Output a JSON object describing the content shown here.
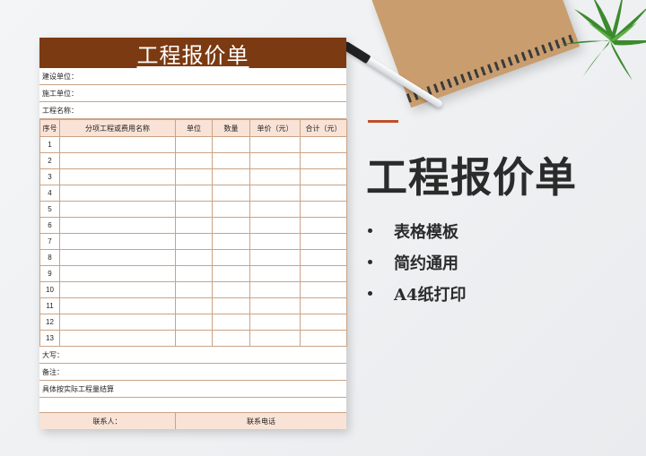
{
  "sheet": {
    "title": "工程报价单",
    "info": [
      "建设单位：",
      "施工单位：",
      "工程名称："
    ],
    "columns": [
      "序号",
      "分项工程或费用名称",
      "单位",
      "数量",
      "单价（元）",
      "合计（元）"
    ],
    "row_numbers": [
      "1",
      "2",
      "3",
      "4",
      "5",
      "6",
      "7",
      "8",
      "9",
      "10",
      "11",
      "12",
      "13"
    ],
    "footer_lines": [
      "大写：",
      "备注：",
      "具体按实际工程量结算",
      ""
    ],
    "contact_label": "联系人：",
    "phone_label": "联系电话"
  },
  "promo": {
    "title": "工程报价单",
    "features": [
      "表格模板",
      "简约通用",
      "A4纸打印"
    ]
  },
  "colors": {
    "header_brown": "#7b3a11",
    "header_fill": "#f9e3d6",
    "accent": "#c0502a"
  }
}
